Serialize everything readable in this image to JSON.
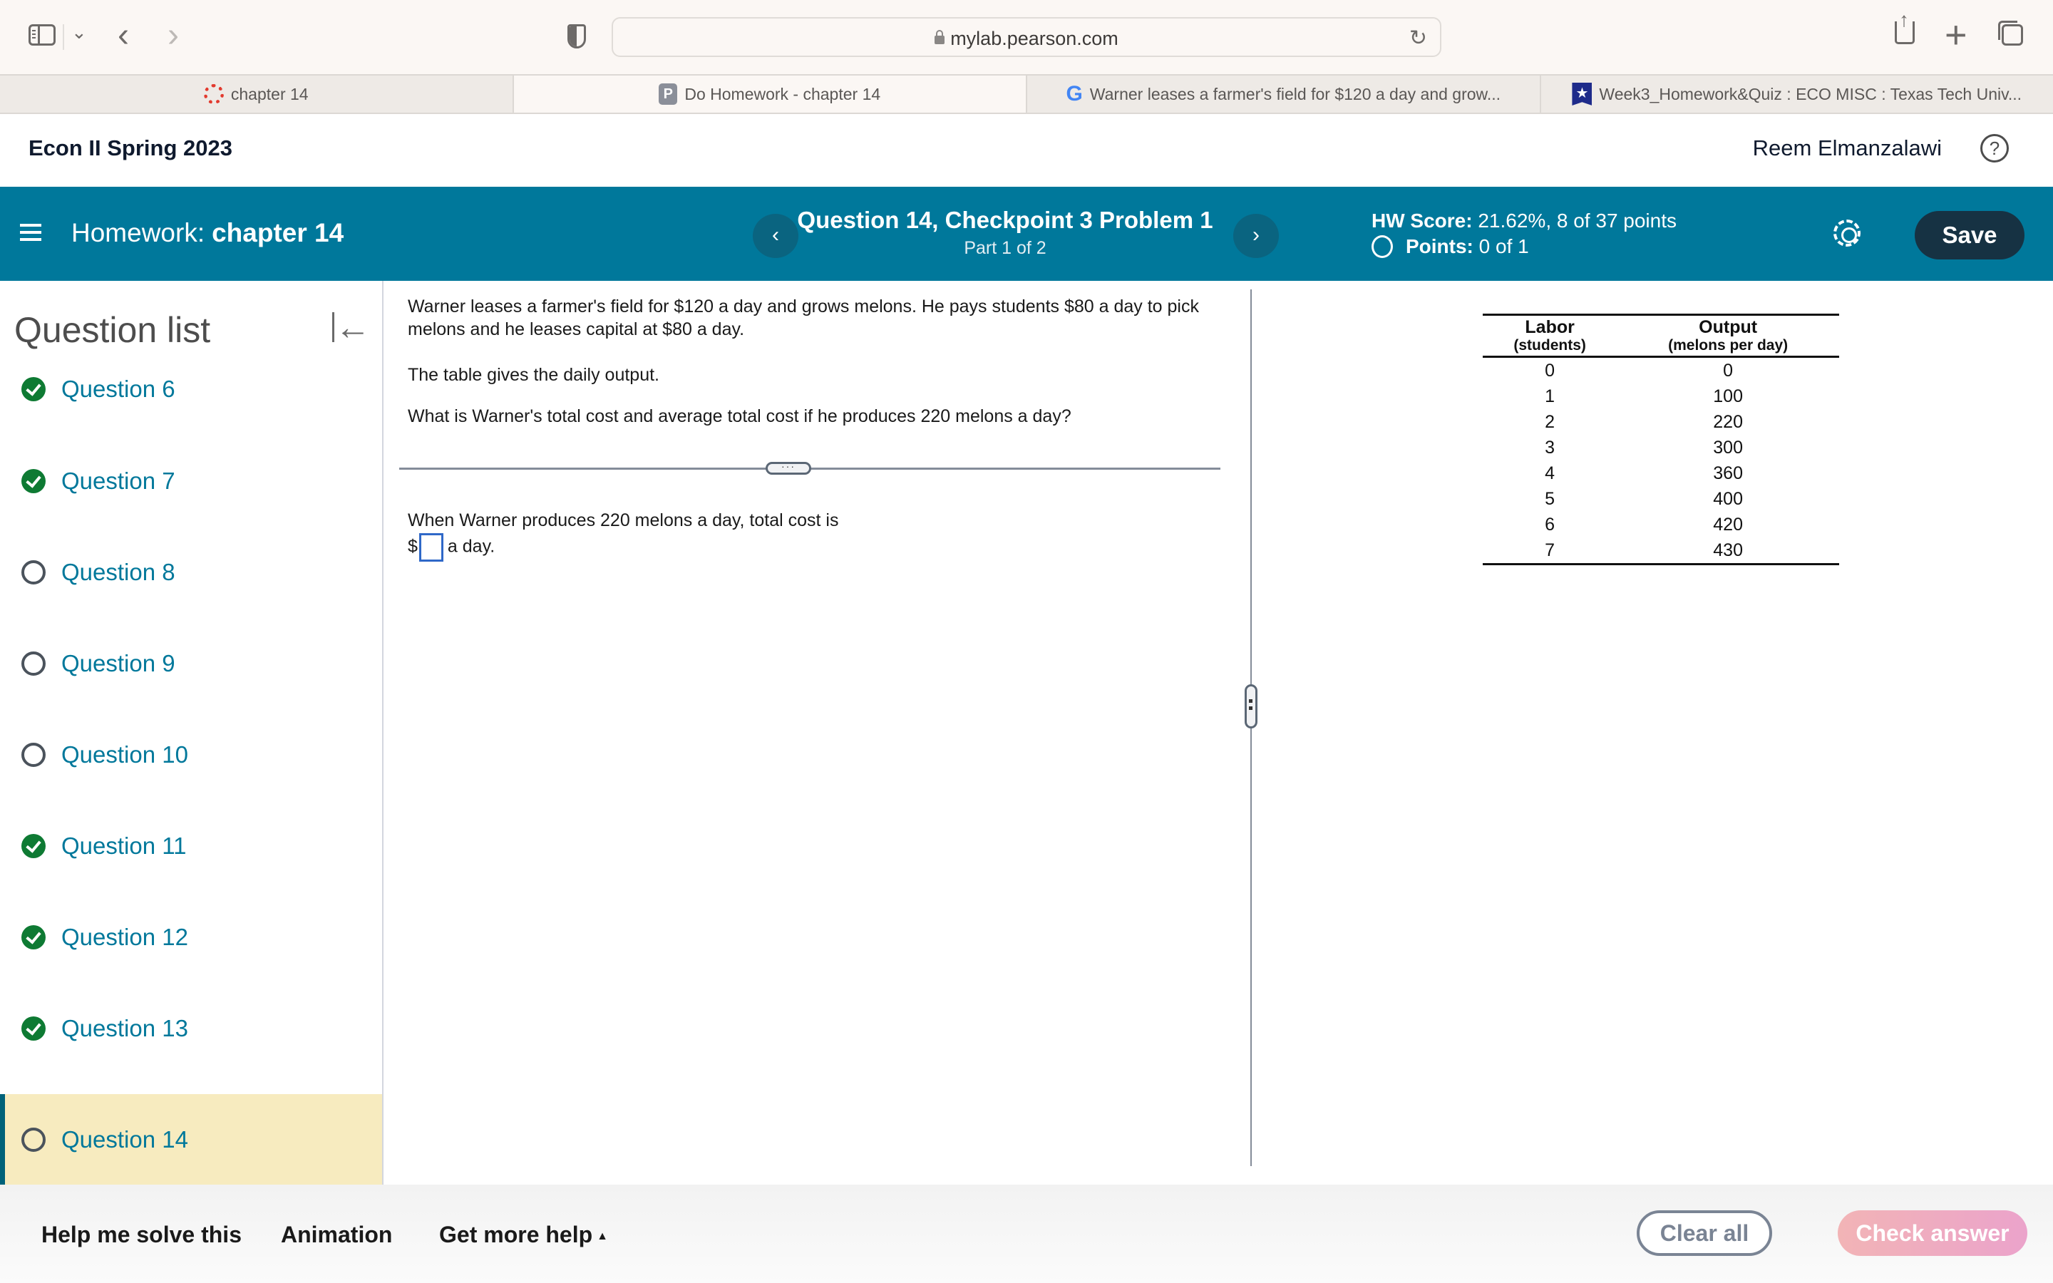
{
  "browser": {
    "url": "mylab.pearson.com",
    "tabs": [
      {
        "label": "chapter 14",
        "icon": "canvas-logo-icon",
        "active": false
      },
      {
        "label": "Do Homework - chapter 14",
        "icon": "pearson-p-icon",
        "icon_text": "P",
        "active": true
      },
      {
        "label": "Warner leases a farmer's field for $120 a day and grow...",
        "icon": "google-g-icon",
        "icon_text": "G",
        "active": false
      },
      {
        "label": "Week3_Homework&Quiz : ECO MISC : Texas Tech Univ...",
        "icon": "ttu-star-icon",
        "icon_text": "★",
        "active": false
      }
    ]
  },
  "course": {
    "title": "Econ II Spring 2023",
    "user": "Reem Elmanzalawi",
    "help_icon": "?"
  },
  "assignment": {
    "label": "Homework:",
    "name": "chapter 14",
    "question_title": "Question 14, Checkpoint 3 Problem 1",
    "part": "Part 1 of 2",
    "prev_icon": "‹",
    "next_icon": "›",
    "hw_score_label": "HW Score:",
    "hw_score_value": "21.62%, 8 of 37 points",
    "points_label": "Points:",
    "points_value": "0 of 1",
    "save_label": "Save"
  },
  "sidebar": {
    "title": "Question list",
    "collapse_icon": "←",
    "questions": [
      {
        "label": "Question 6",
        "status": "completed"
      },
      {
        "label": "Question 7",
        "status": "completed"
      },
      {
        "label": "Question 8",
        "status": "incomplete"
      },
      {
        "label": "Question 9",
        "status": "incomplete"
      },
      {
        "label": "Question 10",
        "status": "incomplete"
      },
      {
        "label": "Question 11",
        "status": "completed"
      },
      {
        "label": "Question 12",
        "status": "completed"
      },
      {
        "label": "Question 13",
        "status": "completed"
      },
      {
        "label": "Question 14",
        "status": "incomplete",
        "current": true
      }
    ]
  },
  "question": {
    "paragraph1": "Warner leases a farmer's field for $120 a day and grows melons. He pays students $80 a day to pick melons and he leases capital at $80 a day.",
    "paragraph2": "The table gives the daily output.",
    "paragraph3": "What is Warner's total cost and average total cost if he produces 220 melons a day?",
    "divider_handle": "···",
    "answer_prompt": "When Warner produces 220 melons a day, total cost is",
    "answer_prefix": "$",
    "answer_value": "",
    "answer_suffix": "a day."
  },
  "table": {
    "col1_header": "Labor",
    "col1_sub": "(students)",
    "col2_header": "Output",
    "col2_sub": "(melons per day)",
    "rows": [
      [
        "0",
        "0"
      ],
      [
        "1",
        "100"
      ],
      [
        "2",
        "220"
      ],
      [
        "3",
        "300"
      ],
      [
        "4",
        "360"
      ],
      [
        "5",
        "400"
      ],
      [
        "6",
        "420"
      ],
      [
        "7",
        "430"
      ]
    ]
  },
  "footer": {
    "help_me_solve": "Help me solve this",
    "animation": "Animation",
    "get_more_help": "Get more help",
    "get_more_help_icon": "▲",
    "clear_all": "Clear all",
    "check_answer": "Check answer"
  }
}
